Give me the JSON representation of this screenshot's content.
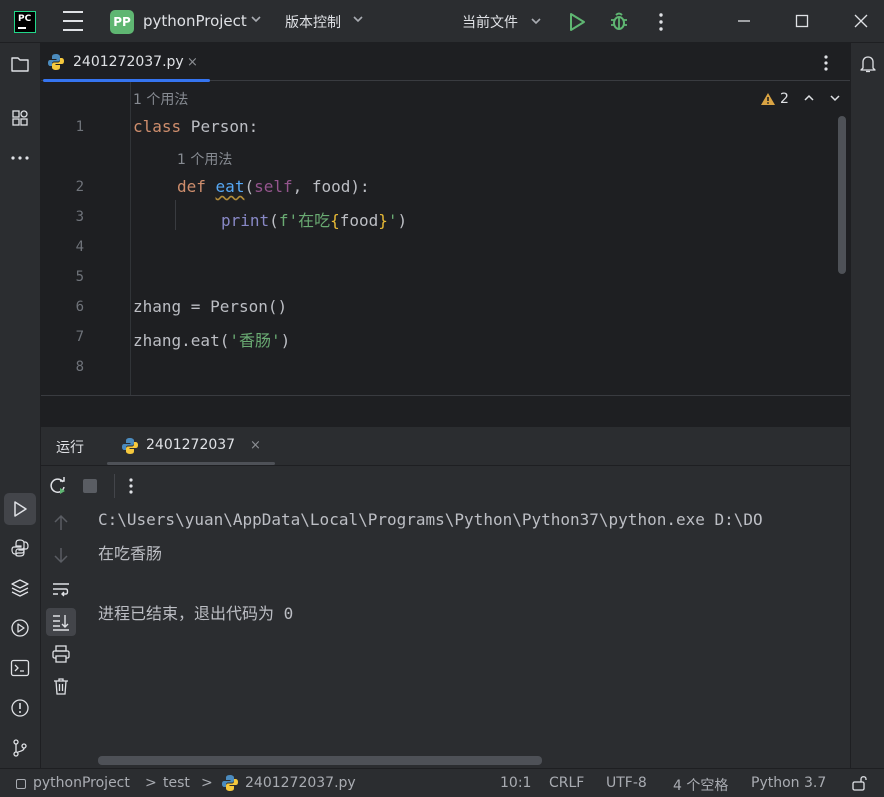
{
  "titlebar": {
    "project_badge": "PP",
    "project_name": "pythonProject",
    "vcs_label": "版本控制",
    "run_config_label": "当前文件"
  },
  "editor": {
    "tab_label": "2401272037.py",
    "tab_close": "×",
    "warnings_count": "2",
    "usage_hint_class": "1 个用法",
    "usage_hint_method": "1 个用法",
    "line_numbers": [
      "1",
      "2",
      "3",
      "4",
      "5",
      "6",
      "7",
      "8"
    ],
    "code": {
      "line1_kw": "class",
      "line1_rest": " Person:",
      "line2_kw": "def",
      "line2_fn": "eat",
      "line2_open": "(",
      "line2_self": "self",
      "line2_rest": ", food):",
      "line3_bi": "print",
      "line3_open": "(",
      "line3_str1": "f'在吃",
      "line3_lb": "{",
      "line3_var": "food",
      "line3_rb": "}",
      "line3_str2": "'",
      "line3_close": ")",
      "line6": "zhang = Person()",
      "line7_pre": "zhang.eat(",
      "line7_str": "'香肠'",
      "line7_post": ")"
    }
  },
  "run_panel": {
    "title": "运行",
    "tab_label": "2401272037",
    "tab_close": "×",
    "console_lines": [
      "C:\\Users\\yuan\\AppData\\Local\\Programs\\Python\\Python37\\python.exe D:\\DO",
      "在吃香肠",
      "",
      "进程已结束，退出代码为 0"
    ]
  },
  "statusbar": {
    "breadcrumb_project": "pythonProject",
    "breadcrumb_folder": "test",
    "breadcrumb_file": "2401272037.py",
    "separator": ">",
    "caret_position": "10:1",
    "line_separator": "CRLF",
    "encoding": "UTF-8",
    "indent": "4 个空格",
    "interpreter": "Python 3.7"
  },
  "colors": {
    "background": "#1e1f22",
    "panel": "#2b2d30",
    "accent": "#3574f0",
    "run_green": "#5fb672",
    "keyword": "#cf8e6d",
    "function": "#56a8f5",
    "string": "#6aab73"
  }
}
